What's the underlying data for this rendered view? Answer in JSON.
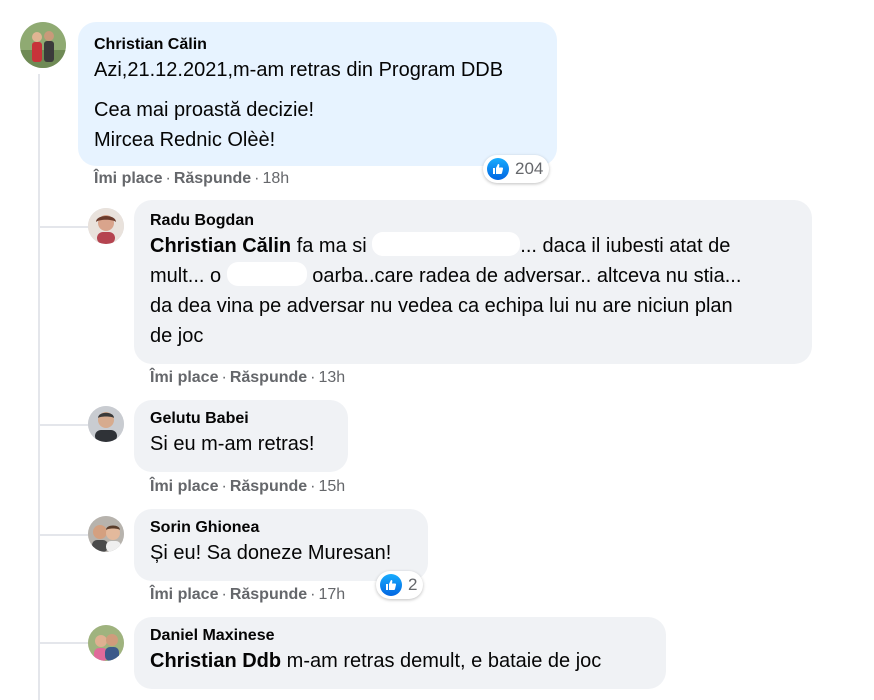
{
  "comments": [
    {
      "author": "Christian Călin",
      "line1": "Azi,21.12.2021,m-am retras din Program DDB",
      "line2": "Cea mai proastă decizie!",
      "line3": "Mircea Rednic Olèè!",
      "like_label": "Îmi place",
      "reply_label": "Răspunde",
      "time": "18h",
      "reactions": "204"
    },
    {
      "author": "Radu Bogdan",
      "mention": "Christian Călin",
      "seg1": " fa ma si ",
      "seg2": "... daca il iubesti atat de",
      "seg3": "mult... o ",
      "seg4": " oarba..care radea de adversar.. altceva nu stia...",
      "seg5": "da dea vina pe adversar nu vedea ca echipa lui nu are niciun plan",
      "seg6": "de joc",
      "like_label": "Îmi place",
      "reply_label": "Răspunde",
      "time": "13h"
    },
    {
      "author": "Gelutu Babei",
      "text": "Si eu m-am retras!",
      "like_label": "Îmi place",
      "reply_label": "Răspunde",
      "time": "15h"
    },
    {
      "author": "Sorin Ghionea",
      "text": "Și eu! Sa doneze Muresan!",
      "like_label": "Îmi place",
      "reply_label": "Răspunde",
      "time": "17h",
      "reactions": "2"
    },
    {
      "author": "Daniel Maxinese",
      "mention": "Christian Ddb",
      "text": " m-am retras demult, e bataie de joc"
    }
  ],
  "colors": {
    "bubble_main": "#e7f3ff",
    "bubble_reply": "#f0f2f5",
    "like_blue": "#1877f2",
    "meta_gray": "#65676b"
  },
  "icons": {
    "reaction": "like-thumb-icon"
  }
}
